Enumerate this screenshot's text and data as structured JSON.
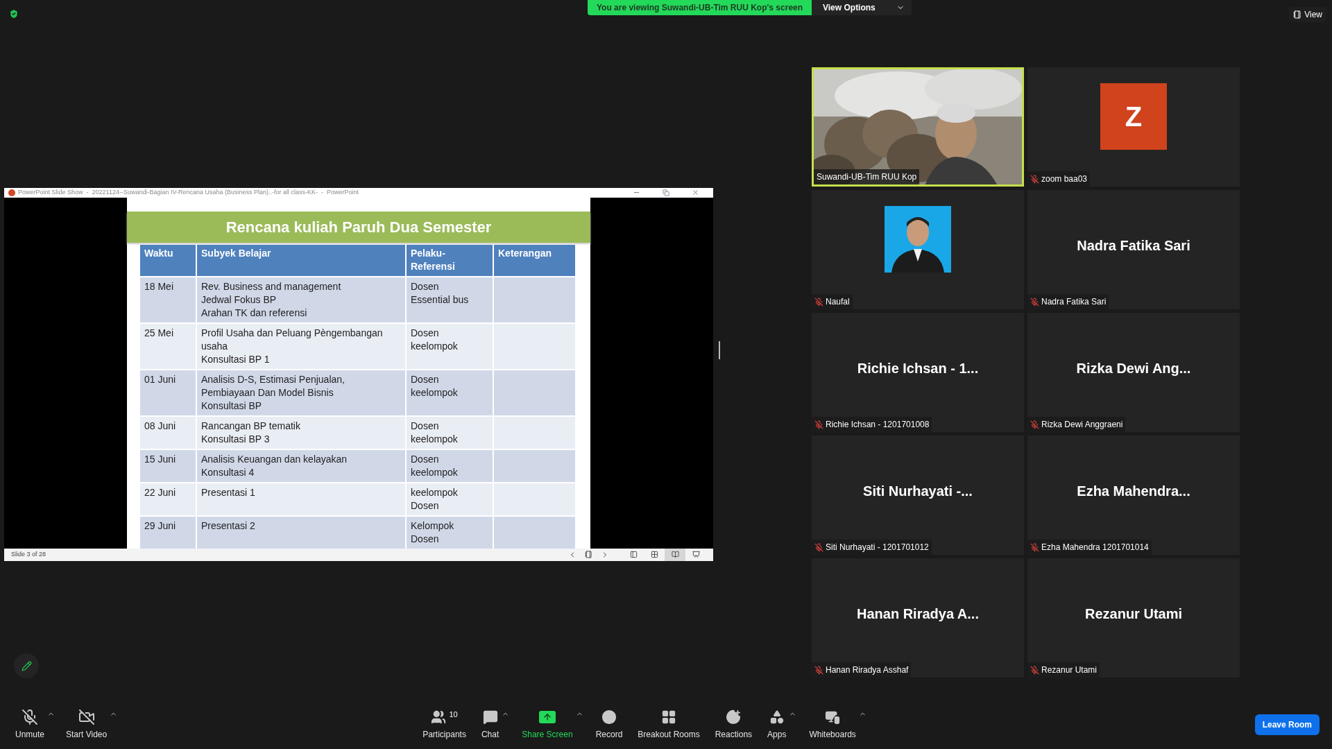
{
  "banner": {
    "text": "You are viewing Suwandi-UB-Tim RUU Kop's screen",
    "button": "View Options"
  },
  "view_button": "View",
  "shared_window": {
    "title": "PowerPoint Slide Show  -  20221124--Suwandi-Bagian IV-Rencana Usaha (Business Plan)..-for all class-KK-  -  PowerPoint",
    "slide": {
      "title": "Rencana kuliah Paruh Dua Semester",
      "columns": [
        "Waktu",
        "Subyek Belajar",
        "Pelaku-Referensi",
        "Keterangan"
      ],
      "rows": [
        {
          "cells": [
            [
              "18 Mei"
            ],
            [
              "Rev. Business and management",
              "Jedwal Fokus BP",
              "Arahan TK dan referensi"
            ],
            [
              "Dosen",
              "Essential bus"
            ],
            []
          ]
        },
        {
          "cells": [
            [
              "25 Mei"
            ],
            [
              "Profil Usaha dan Peluang Pèngembangan",
              "usaha",
              "Konsultasi BP 1"
            ],
            [
              "Dosen",
              "keelompok"
            ],
            []
          ]
        },
        {
          "cells": [
            [
              "01 Juni"
            ],
            [
              "Analisis D-S,  Estimasi Penjualan,",
              "Pembiayaan Dan Model Bisnis",
              "Konsultasi BP"
            ],
            [
              "Dosen",
              "keelompok"
            ],
            []
          ]
        },
        {
          "cells": [
            [
              "08 Juni"
            ],
            [
              "Rancangan BP tematik",
              "Konsultasi BP 3"
            ],
            [
              "Dosen",
              "keelompok"
            ],
            []
          ]
        },
        {
          "cells": [
            [
              "15 Juni"
            ],
            [
              "Analisis Keuangan dan kelayakan",
              "Konsultasi 4"
            ],
            [
              "Dosen",
              "keelompok"
            ],
            []
          ]
        },
        {
          "cells": [
            [
              "22 Juni"
            ],
            [
              "Presentasi 1"
            ],
            [
              "keelompok",
              "Dosen"
            ],
            []
          ]
        },
        {
          "cells": [
            [
              "29 Juni"
            ],
            [
              "Presentasi 2"
            ],
            [
              "Kelompok",
              "Dosen"
            ],
            []
          ]
        }
      ]
    },
    "status": "Slide 3 of 28",
    "view_modes": [
      {
        "kind": "normal",
        "selected": false
      },
      {
        "kind": "sorter",
        "selected": false
      },
      {
        "kind": "reading",
        "selected": true
      },
      {
        "kind": "slideshow",
        "selected": false
      }
    ]
  },
  "participants": [
    {
      "name": "Suwandi-UB-Tim RUU Kop",
      "kind": "video",
      "speaking": true,
      "muted": false
    },
    {
      "name": "zoom baa03",
      "kind": "avatar",
      "initial": "Z",
      "color": "#d0431c",
      "speaking": false,
      "muted": true
    },
    {
      "name": "Naufal",
      "speaking": false,
      "muted": true
    },
    {
      "name": "Nadra Fatika Sari",
      "kind": "name",
      "display": "Nadra Fatika Sari",
      "speaking": false,
      "muted": true
    },
    {
      "name": "Richie Ichsan - 1201701008",
      "kind": "name",
      "display": "Richie Ichsan - 1...",
      "speaking": false,
      "muted": true
    },
    {
      "name": "Rizka Dewi Anggraeni",
      "kind": "name",
      "display": "Rizka Dewi Ang...",
      "speaking": false,
      "muted": true
    },
    {
      "name": "Siti Nurhayati - 1201701012",
      "kind": "name",
      "display": "Siti Nurhayati -...",
      "speaking": false,
      "muted": true
    },
    {
      "name": "Ezha Mahendra 1201701014",
      "kind": "name",
      "display": "Ezha Mahendra...",
      "speaking": false,
      "muted": true
    },
    {
      "name": "Hanan Riradya Asshaf",
      "kind": "name",
      "display": "Hanan Riradya A...",
      "speaking": false,
      "muted": true
    },
    {
      "name": "Rezanur Utami",
      "kind": "name",
      "display": "Rezanur Utami",
      "speaking": false,
      "muted": true
    }
  ],
  "toolbar": {
    "left": [
      {
        "label": "Unmute",
        "kind": "mic",
        "caret": true
      },
      {
        "label": "Start Video",
        "kind": "video",
        "caret": true
      }
    ],
    "center": [
      {
        "label": "Participants",
        "kind": "participants",
        "count": "10",
        "caret": false
      },
      {
        "label": "Chat",
        "kind": "chat",
        "caret": true
      },
      {
        "label": "Share Screen",
        "kind": "share",
        "caret": true
      },
      {
        "label": "Record",
        "kind": "record",
        "caret": false
      },
      {
        "label": "Breakout Rooms",
        "kind": "breakout",
        "caret": false
      },
      {
        "label": "Reactions",
        "kind": "reactions",
        "caret": false
      },
      {
        "label": "Apps",
        "kind": "apps",
        "caret": true
      },
      {
        "label": "Whiteboards",
        "kind": "whiteboards",
        "caret": true
      }
    ],
    "leave": "Leave Room"
  }
}
